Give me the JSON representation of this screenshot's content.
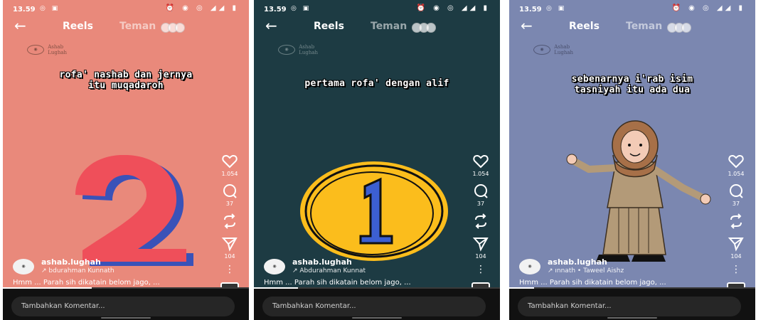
{
  "screens": [
    {
      "status": {
        "time": "13.59",
        "apps": "◎ ▣",
        "icons": "⏰ ◉ ◎ ◢◢ ▮"
      },
      "nav": {
        "back": "←",
        "title": "Reels",
        "tab": "Teman"
      },
      "logo": {
        "line1": "Ashab",
        "line2": "Lughah"
      },
      "caption": [
        "rofa' nashab dan jernya",
        "itu muqadaroh"
      ],
      "likes": "1.054",
      "comments": "37",
      "shares": "104",
      "more": "⋮",
      "account": "ashab.lughah",
      "audio": "↗ bdurahman Kunnath",
      "description": "Hmm ... Parah sih dikatain belom jago, ...",
      "comment_placeholder": "Tambahkan Komentar...",
      "progress": 0.36,
      "bg": "#e9897b",
      "art": {
        "type": "number",
        "digit": "2"
      }
    },
    {
      "status": {
        "time": "13.59",
        "apps": "◎ ▣",
        "icons": "⏰ ◉ ◎ ◢◢ ▮"
      },
      "nav": {
        "back": "←",
        "title": "Reels",
        "tab": "Teman"
      },
      "logo": {
        "line1": "Ashab",
        "line2": "Lughah"
      },
      "caption": [
        "pertama rofa' dengan alif"
      ],
      "likes": "1.054",
      "comments": "37",
      "shares": "104",
      "more": "⋮",
      "account": "ashab.lughah",
      "audio": "↗ Abdurahman Kunnat",
      "description": "Hmm ... Parah sih dikatain belom jago, ...",
      "comment_placeholder": "Tambahkan Komentar...",
      "progress": 0.18,
      "bg": "#1d3b43",
      "art": {
        "type": "circle",
        "digit": "1"
      }
    },
    {
      "status": {
        "time": "13.59",
        "apps": "◎ ▣",
        "icons": "⏰ ◉ ◎ ◢◢ ▮"
      },
      "nav": {
        "back": "←",
        "title": "Reels",
        "tab": "Teman"
      },
      "logo": {
        "line1": "Ashab",
        "line2": "Lughah"
      },
      "caption": [
        "sebenarnya i'rab isim",
        "tasniyah itu ada dua"
      ],
      "likes": "1.054",
      "comments": "37",
      "shares": "104",
      "more": "⋮",
      "account": "ashab.lughah",
      "audio": "↗ ınnath • Taweel Aishz",
      "description": "Hmm ... Parah sih dikatain belom jago, ...",
      "comment_placeholder": "Tambahkan Komentar...",
      "progress": 0.1,
      "bg": "#7b87b0",
      "art": {
        "type": "person"
      }
    }
  ]
}
